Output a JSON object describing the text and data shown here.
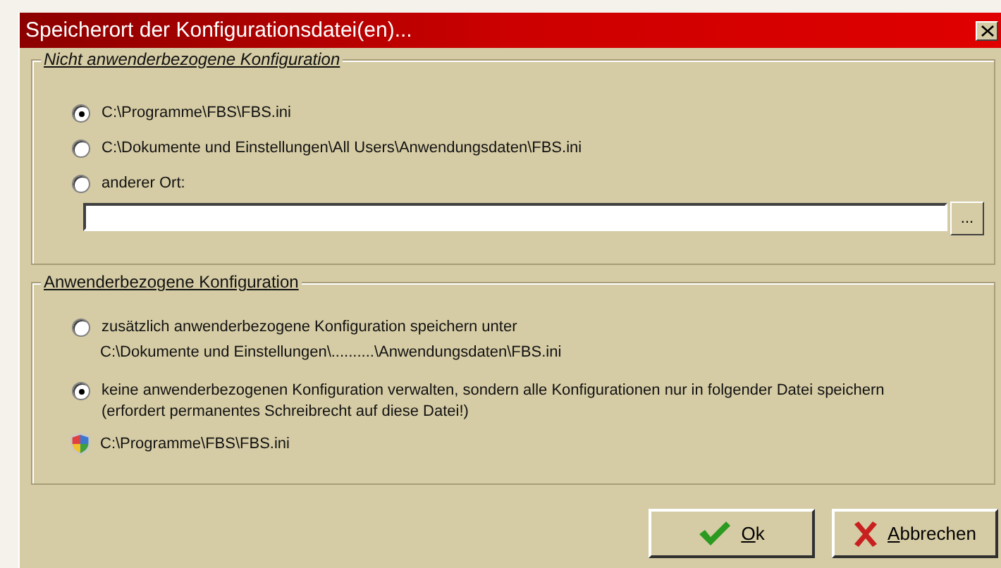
{
  "window": {
    "title": "Speicherort der Konfigurationsdatei(en)..."
  },
  "groups": [
    {
      "legend": "Nicht anwenderbezogene Konfiguration",
      "italic": true,
      "options": [
        {
          "label": "C:\\Programme\\FBS\\FBS.ini",
          "selected": true
        },
        {
          "label": "C:\\Dokumente und Einstellungen\\All Users\\Anwendungsdaten\\FBS.ini",
          "selected": false
        },
        {
          "label": "anderer Ort:",
          "selected": false
        }
      ],
      "browse_button": "..."
    },
    {
      "legend": "Anwenderbezogene Konfiguration",
      "italic": false,
      "options": [
        {
          "label": "zusätzlich anwenderbezogene Konfiguration speichern unter",
          "selected": false,
          "path": "C:\\Dokumente und Einstellungen\\..........\\Anwendungsdaten\\FBS.ini",
          "kind": "plain"
        },
        {
          "label": "keine anwenderbezogenen Konfiguration verwalten, sondern alle Konfigurationen nur in folgender Datei speichern (erfordert permanentes Schreibrecht auf diese Datei!)",
          "selected": true,
          "path": "C:\\Programme\\FBS\\FBS.ini",
          "kind": "shielded"
        }
      ]
    }
  ],
  "buttons": [
    {
      "label": "Ok",
      "kind": "check"
    },
    {
      "label": "Abbrechen",
      "kind": "cross"
    }
  ]
}
